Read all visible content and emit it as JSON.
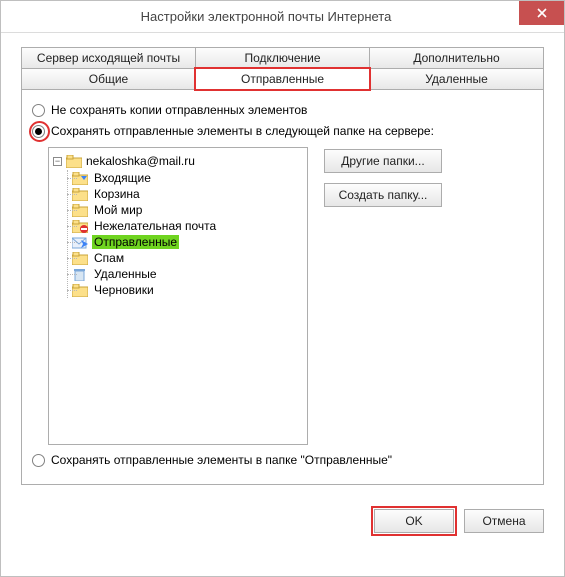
{
  "title": "Настройки электронной почты Интернета",
  "tabs": {
    "row1": [
      "Сервер исходящей почты",
      "Подключение",
      "Дополнительно"
    ],
    "row2": [
      "Общие",
      "Отправленные",
      "Удаленные"
    ]
  },
  "radios": {
    "opt1": "Не сохранять копии отправленных элементов",
    "opt2": "Сохранять отправленные элементы в следующей папке на сервере:",
    "opt3": "Сохранять отправленные элементы в папке \"Отправленные\""
  },
  "tree": {
    "root": "nekaloshka@mail.ru",
    "items": [
      {
        "label": "Входящие",
        "icon": "inbox"
      },
      {
        "label": "Корзина",
        "icon": "folder"
      },
      {
        "label": "Мой мир",
        "icon": "folder"
      },
      {
        "label": "Нежелательная почта",
        "icon": "junk"
      },
      {
        "label": "Отправленные",
        "icon": "sent",
        "selected": true
      },
      {
        "label": "Спам",
        "icon": "folder"
      },
      {
        "label": "Удаленные",
        "icon": "deleted"
      },
      {
        "label": "Черновики",
        "icon": "folder"
      }
    ]
  },
  "buttons": {
    "other_folders": "Другие папки...",
    "create_folder": "Создать папку...",
    "ok": "OK",
    "cancel": "Отмена"
  }
}
